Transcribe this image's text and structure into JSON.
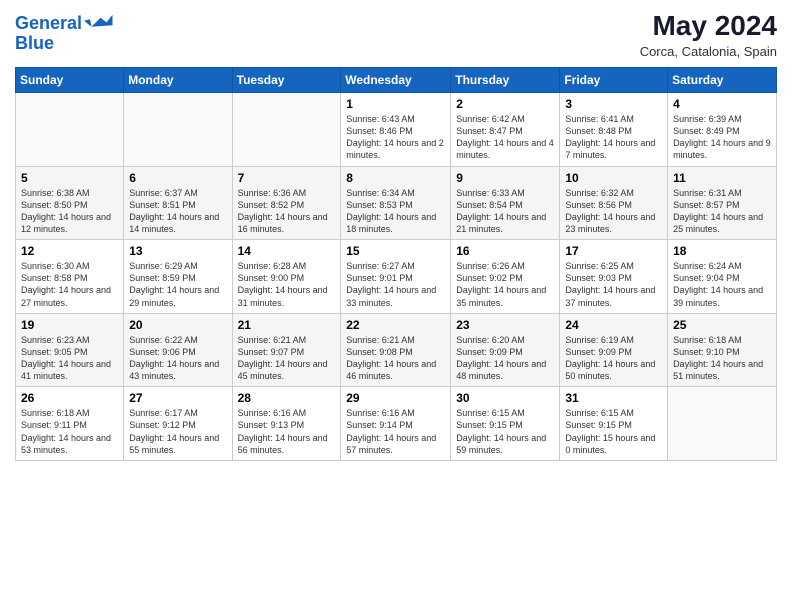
{
  "header": {
    "logo_line1": "General",
    "logo_line2": "Blue",
    "month_year": "May 2024",
    "location": "Corca, Catalonia, Spain"
  },
  "days_of_week": [
    "Sunday",
    "Monday",
    "Tuesday",
    "Wednesday",
    "Thursday",
    "Friday",
    "Saturday"
  ],
  "weeks": [
    [
      {
        "day": "",
        "content": ""
      },
      {
        "day": "",
        "content": ""
      },
      {
        "day": "",
        "content": ""
      },
      {
        "day": "1",
        "content": "Sunrise: 6:43 AM\nSunset: 8:46 PM\nDaylight: 14 hours\nand 2 minutes."
      },
      {
        "day": "2",
        "content": "Sunrise: 6:42 AM\nSunset: 8:47 PM\nDaylight: 14 hours\nand 4 minutes."
      },
      {
        "day": "3",
        "content": "Sunrise: 6:41 AM\nSunset: 8:48 PM\nDaylight: 14 hours\nand 7 minutes."
      },
      {
        "day": "4",
        "content": "Sunrise: 6:39 AM\nSunset: 8:49 PM\nDaylight: 14 hours\nand 9 minutes."
      }
    ],
    [
      {
        "day": "5",
        "content": "Sunrise: 6:38 AM\nSunset: 8:50 PM\nDaylight: 14 hours\nand 12 minutes."
      },
      {
        "day": "6",
        "content": "Sunrise: 6:37 AM\nSunset: 8:51 PM\nDaylight: 14 hours\nand 14 minutes."
      },
      {
        "day": "7",
        "content": "Sunrise: 6:36 AM\nSunset: 8:52 PM\nDaylight: 14 hours\nand 16 minutes."
      },
      {
        "day": "8",
        "content": "Sunrise: 6:34 AM\nSunset: 8:53 PM\nDaylight: 14 hours\nand 18 minutes."
      },
      {
        "day": "9",
        "content": "Sunrise: 6:33 AM\nSunset: 8:54 PM\nDaylight: 14 hours\nand 21 minutes."
      },
      {
        "day": "10",
        "content": "Sunrise: 6:32 AM\nSunset: 8:56 PM\nDaylight: 14 hours\nand 23 minutes."
      },
      {
        "day": "11",
        "content": "Sunrise: 6:31 AM\nSunset: 8:57 PM\nDaylight: 14 hours\nand 25 minutes."
      }
    ],
    [
      {
        "day": "12",
        "content": "Sunrise: 6:30 AM\nSunset: 8:58 PM\nDaylight: 14 hours\nand 27 minutes."
      },
      {
        "day": "13",
        "content": "Sunrise: 6:29 AM\nSunset: 8:59 PM\nDaylight: 14 hours\nand 29 minutes."
      },
      {
        "day": "14",
        "content": "Sunrise: 6:28 AM\nSunset: 9:00 PM\nDaylight: 14 hours\nand 31 minutes."
      },
      {
        "day": "15",
        "content": "Sunrise: 6:27 AM\nSunset: 9:01 PM\nDaylight: 14 hours\nand 33 minutes."
      },
      {
        "day": "16",
        "content": "Sunrise: 6:26 AM\nSunset: 9:02 PM\nDaylight: 14 hours\nand 35 minutes."
      },
      {
        "day": "17",
        "content": "Sunrise: 6:25 AM\nSunset: 9:03 PM\nDaylight: 14 hours\nand 37 minutes."
      },
      {
        "day": "18",
        "content": "Sunrise: 6:24 AM\nSunset: 9:04 PM\nDaylight: 14 hours\nand 39 minutes."
      }
    ],
    [
      {
        "day": "19",
        "content": "Sunrise: 6:23 AM\nSunset: 9:05 PM\nDaylight: 14 hours\nand 41 minutes."
      },
      {
        "day": "20",
        "content": "Sunrise: 6:22 AM\nSunset: 9:06 PM\nDaylight: 14 hours\nand 43 minutes."
      },
      {
        "day": "21",
        "content": "Sunrise: 6:21 AM\nSunset: 9:07 PM\nDaylight: 14 hours\nand 45 minutes."
      },
      {
        "day": "22",
        "content": "Sunrise: 6:21 AM\nSunset: 9:08 PM\nDaylight: 14 hours\nand 46 minutes."
      },
      {
        "day": "23",
        "content": "Sunrise: 6:20 AM\nSunset: 9:09 PM\nDaylight: 14 hours\nand 48 minutes."
      },
      {
        "day": "24",
        "content": "Sunrise: 6:19 AM\nSunset: 9:09 PM\nDaylight: 14 hours\nand 50 minutes."
      },
      {
        "day": "25",
        "content": "Sunrise: 6:18 AM\nSunset: 9:10 PM\nDaylight: 14 hours\nand 51 minutes."
      }
    ],
    [
      {
        "day": "26",
        "content": "Sunrise: 6:18 AM\nSunset: 9:11 PM\nDaylight: 14 hours\nand 53 minutes."
      },
      {
        "day": "27",
        "content": "Sunrise: 6:17 AM\nSunset: 9:12 PM\nDaylight: 14 hours\nand 55 minutes."
      },
      {
        "day": "28",
        "content": "Sunrise: 6:16 AM\nSunset: 9:13 PM\nDaylight: 14 hours\nand 56 minutes."
      },
      {
        "day": "29",
        "content": "Sunrise: 6:16 AM\nSunset: 9:14 PM\nDaylight: 14 hours\nand 57 minutes."
      },
      {
        "day": "30",
        "content": "Sunrise: 6:15 AM\nSunset: 9:15 PM\nDaylight: 14 hours\nand 59 minutes."
      },
      {
        "day": "31",
        "content": "Sunrise: 6:15 AM\nSunset: 9:15 PM\nDaylight: 15 hours\nand 0 minutes."
      },
      {
        "day": "",
        "content": ""
      }
    ]
  ]
}
